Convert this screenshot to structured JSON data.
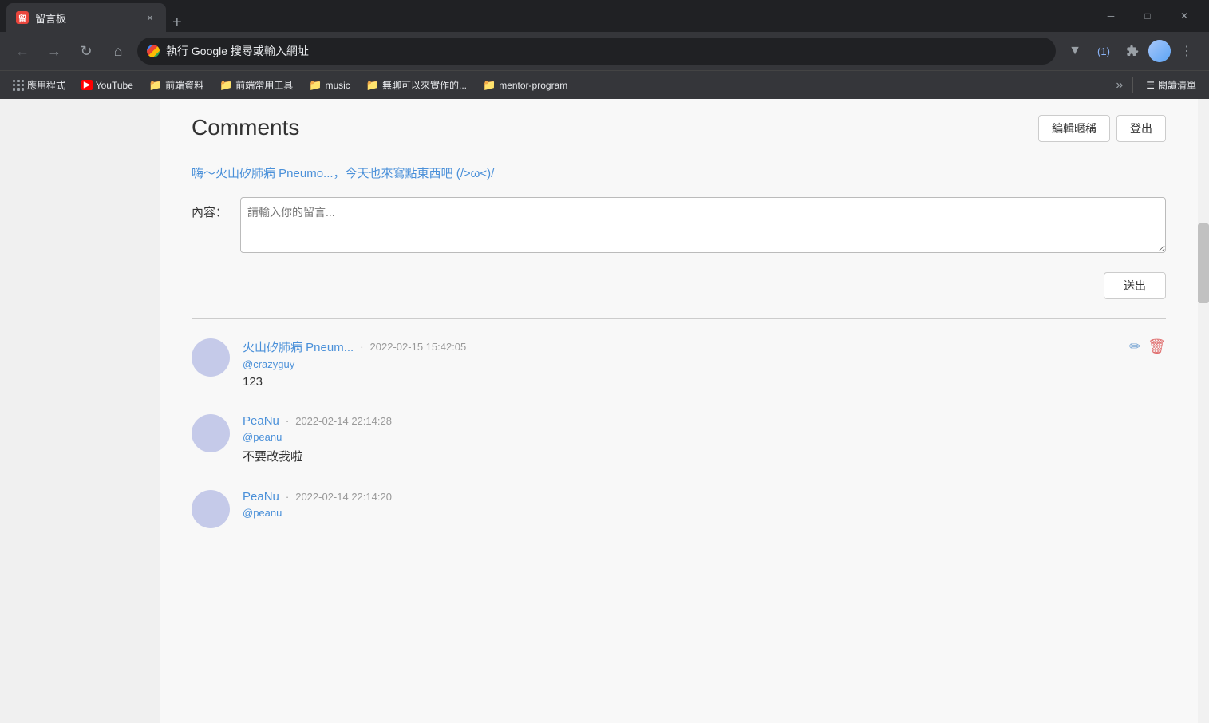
{
  "browser": {
    "tab": {
      "favicon_label": "留",
      "title": "留言板",
      "close_label": "×"
    },
    "tab_add_label": "+",
    "window_controls": {
      "minimize": "─",
      "maximize": "□",
      "close": "✕"
    },
    "nav": {
      "back": "←",
      "forward": "→",
      "reload": "↻",
      "home": "⌂",
      "address": "執行 Google 搜尋或輸入網址",
      "dropdown_arrow": "▼",
      "counter": "(1)",
      "extensions_icon": "puzzle",
      "profile_icon": "person",
      "menu_icon": "⋮"
    },
    "bookmarks": [
      {
        "type": "apps",
        "label": "應用程式"
      },
      {
        "type": "youtube",
        "label": "YouTube"
      },
      {
        "type": "folder",
        "label": "前端資料"
      },
      {
        "type": "folder",
        "label": "前端常用工具"
      },
      {
        "type": "folder",
        "label": "music"
      },
      {
        "type": "folder",
        "label": "無聊可以來實作的..."
      },
      {
        "type": "folder",
        "label": "mentor-program"
      }
    ],
    "bookmarks_more": "»",
    "reading_list_icon": "☰",
    "reading_list_label": "閱讀清單"
  },
  "page": {
    "title": "Comments",
    "edit_draft_btn": "編輯暱稱",
    "logout_btn": "登出",
    "welcome_msg": "嗨～火山矽肺病 Pneumo...，今天也來寫點東西吧 (/>ω<)/",
    "form": {
      "label": "內容：",
      "placeholder": "請輸入你的留言...",
      "submit_btn": "送出"
    },
    "comments": [
      {
        "avatar_bg": "#c5cae9",
        "author": "火山矽肺病 Pneum...",
        "date": "2022-02-15 15:42:05",
        "handle": "@crazyguy",
        "text": "123",
        "editable": true
      },
      {
        "avatar_bg": "#c5cae9",
        "author": "PeaNu",
        "date": "2022-02-14 22:14:28",
        "handle": "@peanu",
        "text": "不要改我啦",
        "editable": false
      },
      {
        "avatar_bg": "#c5cae9",
        "author": "PeaNu",
        "date": "2022-02-14 22:14:20",
        "handle": "@peanu",
        "text": "",
        "editable": false
      }
    ]
  }
}
